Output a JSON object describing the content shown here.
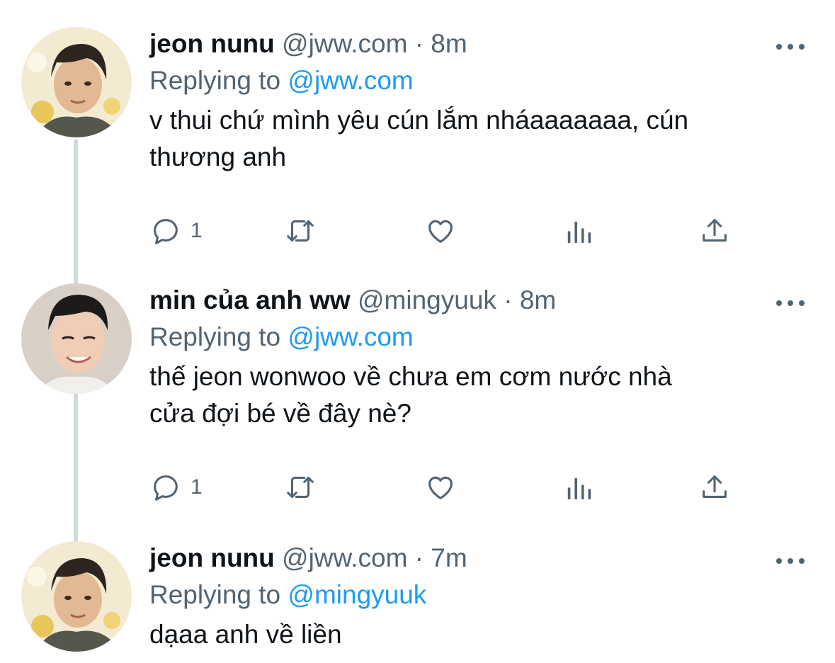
{
  "tweets": [
    {
      "name": "jeon nunu",
      "handle": "@jww.com",
      "time": "8m",
      "replying_prefix": "Replying to",
      "replying_to": "@jww.com",
      "text_lines": [
        "v thui chứ mình yêu cún lắm nháaaaaaaa, cún",
        "thương anh"
      ],
      "reply_count": "1",
      "avatar": "avatar-jeon-nunu"
    },
    {
      "name": "min của anh ww",
      "handle": "@mingyuuk",
      "time": "8m",
      "replying_prefix": "Replying to",
      "replying_to": "@jww.com",
      "text_lines": [
        "thế jeon wonwoo về chưa em cơm nước nhà",
        "cửa đợi bé về đây nè?"
      ],
      "reply_count": "1",
      "avatar": "avatar-min"
    },
    {
      "name": "jeon nunu",
      "handle": "@jww.com",
      "time": "7m",
      "replying_prefix": "Replying to",
      "replying_to": "@mingyuuk",
      "text_lines": [
        "dạaa anh về liền"
      ],
      "avatar": "avatar-jeon-nunu"
    }
  ],
  "separator": "·",
  "icons": [
    "reply-icon",
    "retweet-icon",
    "like-icon",
    "analytics-icon",
    "share-icon",
    "more-icon"
  ],
  "colors": {
    "text": "#0f1419",
    "secondary": "#536471",
    "link": "#1d9bf0",
    "thread": "#cfd9de"
  }
}
